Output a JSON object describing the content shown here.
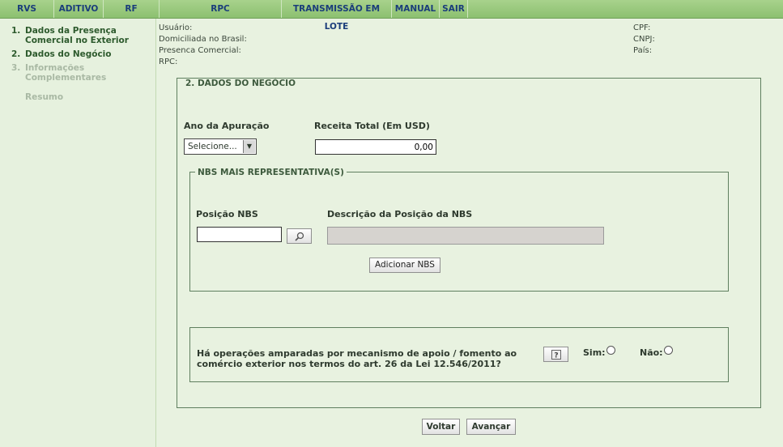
{
  "menu": [
    "RVS",
    "ADITIVO",
    "RF",
    "RPC",
    "TRANSMISSÃO EM LOTE",
    "MANUAL",
    "SAIR"
  ],
  "steps": [
    {
      "num": "1.",
      "label": "Dados da Presença Comercial no Exterior"
    },
    {
      "num": "2.",
      "label": "Dados do Negócio"
    },
    {
      "num": "3.",
      "label": "Informações Complementares"
    },
    {
      "num": "",
      "label": "Resumo"
    }
  ],
  "header_info": {
    "usuario": "Usuário:",
    "domiciliada": "Domiciliada no Brasil:",
    "presenca": "Presenca Comercial:",
    "rpc": "RPC:",
    "cpf": "CPF:",
    "cnpj": "CNPJ:",
    "pais": "País:"
  },
  "section": {
    "title": "2. DADOS DO NEGÓCIO",
    "ano_label": "Ano da Apuração",
    "ano_value": "Selecione...",
    "receita_label": "Receita Total (Em USD)",
    "receita_value": "0,00"
  },
  "nbs": {
    "title": "NBS MAIS REPRESENTATIVA(S)",
    "posicao_label": "Posição NBS",
    "posicao_value": "",
    "descricao_label": "Descrição da Posição da NBS",
    "descricao_value": "",
    "add_button": "Adicionar NBS"
  },
  "question": {
    "text": "Há operações amparadas por mecanismo de apoio / fomento ao comércio exterior nos termos do art. 26 da Lei 12.546/2011?",
    "sim": "Sim:",
    "nao": "Não:"
  },
  "buttons": {
    "voltar": "Voltar",
    "avancar": "Avançar"
  }
}
